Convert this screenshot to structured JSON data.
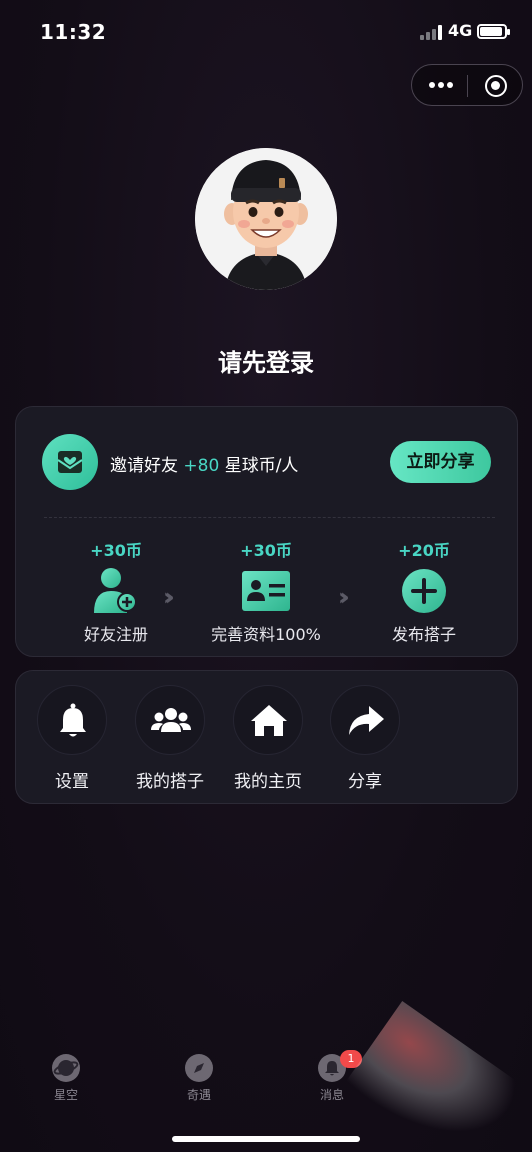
{
  "status_bar": {
    "time": "11:32",
    "network": "4G",
    "battery_level": 0.9
  },
  "profile": {
    "login_prompt": "请先登录"
  },
  "invite": {
    "text_prefix": "邀请好友",
    "bonus": "+80",
    "text_suffix": "星球币/人",
    "share_button": "立即分享",
    "steps": [
      {
        "coins": "+30币",
        "label": "好友注册",
        "icon": "add-user-icon"
      },
      {
        "coins": "+30币",
        "label": "完善资料100%",
        "icon": "id-card-icon"
      },
      {
        "coins": "+20币",
        "label": "发布搭子",
        "icon": "plus-circle-icon"
      }
    ]
  },
  "menu": [
    {
      "label": "设置",
      "icon": "bell-icon"
    },
    {
      "label": "我的搭子",
      "icon": "group-icon"
    },
    {
      "label": "我的主页",
      "icon": "home-icon"
    },
    {
      "label": "分享",
      "icon": "share-arrow-icon"
    }
  ],
  "tab_bar": [
    {
      "label": "星空",
      "icon": "planet-icon"
    },
    {
      "label": "奇遇",
      "icon": "compass-icon"
    },
    {
      "label": "消息",
      "icon": "bell-icon",
      "badge": "1"
    }
  ],
  "colors": {
    "accent": "#49d6c4",
    "button": "#52d8b2",
    "background": "#130d17",
    "card": "#1b1a24"
  }
}
